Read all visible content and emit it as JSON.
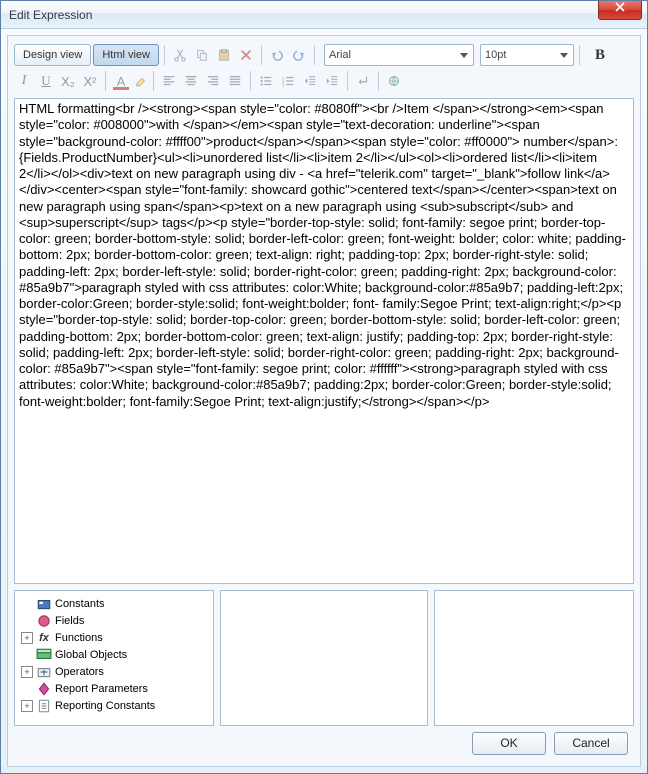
{
  "window": {
    "title": "Edit Expression"
  },
  "views": {
    "design": "Design view",
    "html": "Html view"
  },
  "font": {
    "name": "Arial",
    "size": "10pt"
  },
  "toolbar_icons": {
    "cut": "cut-icon",
    "copy": "copy-icon",
    "paste": "paste-icon",
    "delete": "delete-icon",
    "undo": "undo-icon",
    "redo": "redo-icon",
    "bold": "B",
    "italic": "I",
    "underline": "U",
    "sub": "X₂",
    "sup": "X²",
    "textcolor": "A",
    "highlight": "ab",
    "alignl": "align-left-icon",
    "alignc": "align-center-icon",
    "alignr": "align-right-icon",
    "alignj": "align-justify-icon",
    "ul": "bulleted-list-icon",
    "ol": "numbered-list-icon",
    "outdent": "outdent-icon",
    "indent": "indent-icon",
    "break": "break-icon",
    "link": "hyperlink-icon"
  },
  "html_content": "HTML formatting<br /><strong><span style=\"color: #8080ff\"><br />Item </span></strong><em><span style=\"color: #008000\">with </span></em><span style=\"text-decoration: underline\"><span style=\"background-color: #ffff00\">product</span></span><span style=\"color: #ff0000\"> number</span>: {Fields.ProductNumber}<ul><li>unordered list</li><li>item 2</li></ul><ol><li>ordered list</li><li>item 2</li></ol><div>text on new paragraph using div - <a href=\"telerik.com\" target=\"_blank\">follow link</a></div><center><span style=\"font-family: showcard gothic\">centered text</span></center><span>text on new paragraph using span</span><p>text on a new paragraph using <sub>subscript</sub> and <sup>superscript</sup> tags</p><p style=\"border-top-style: solid; font-family: segoe print; border-top-color: green; border-bottom-style: solid; border-left-color: green; font-weight: bolder; color: white; padding-bottom: 2px; border-bottom-color: green; text-align: right; padding-top: 2px; border-right-style: solid; padding-left: 2px; border-left-style: solid; border-right-color: green; padding-right: 2px; background-color: #85a9b7\">paragraph styled with css attributes: color:White; background-color:#85a9b7; padding-left:2px; border-color:Green; border-style:solid; font-weight:bolder; font- family:Segoe Print; text-align:right;</p><p style=\"border-top-style: solid; border-top-color: green; border-bottom-style: solid; border-left-color: green; padding-bottom: 2px; border-bottom-color: green; text-align: justify; padding-top: 2px; border-right-style: solid; padding-left: 2px; border-left-style: solid; border-right-color: green; padding-right: 2px; background-color: #85a9b7\"><span style=\"font-family: segoe print; color: #ffffff\"><strong>paragraph styled with css attributes: color:White; background-color:#85a9b7; padding:2px; border-color:Green; border-style:solid; font-weight:bolder; font-family:Segoe Print; text-align:justify;</strong></span></p>",
  "tree": {
    "items": [
      {
        "label": "Constants",
        "icon": "constants",
        "expandable": false
      },
      {
        "label": "Fields",
        "icon": "fields",
        "expandable": false
      },
      {
        "label": "Functions",
        "icon": "functions",
        "expandable": true
      },
      {
        "label": "Global Objects",
        "icon": "globals",
        "expandable": false
      },
      {
        "label": "Operators",
        "icon": "operators",
        "expandable": true
      },
      {
        "label": "Report Parameters",
        "icon": "params",
        "expandable": false
      },
      {
        "label": "Reporting Constants",
        "icon": "repconst",
        "expandable": true
      }
    ]
  },
  "buttons": {
    "ok": "OK",
    "cancel": "Cancel"
  }
}
